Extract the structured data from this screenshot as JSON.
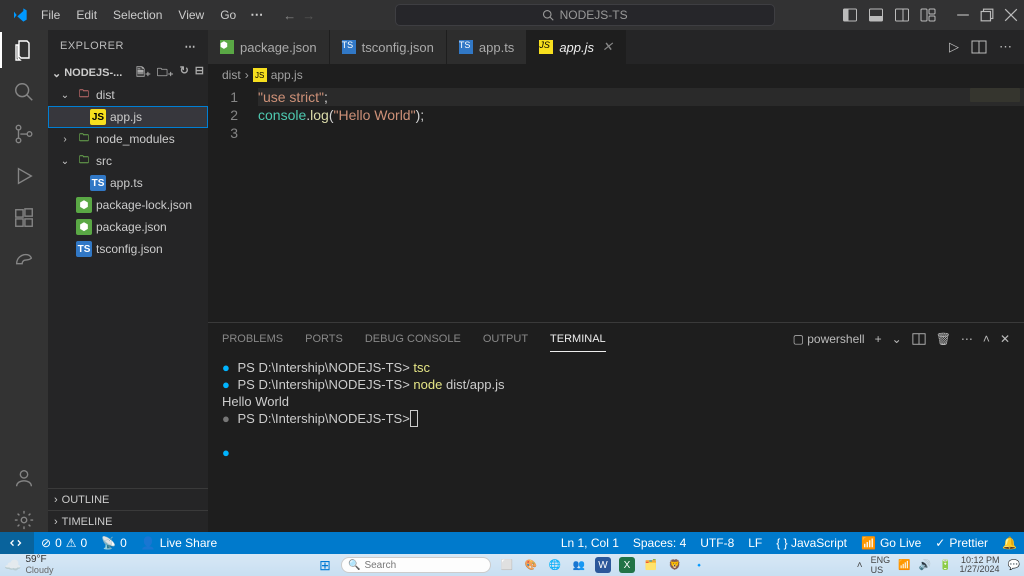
{
  "title_menu": [
    "File",
    "Edit",
    "Selection",
    "View",
    "Go"
  ],
  "search_placeholder": "NODEJS-TS",
  "explorer": {
    "title": "EXPLORER",
    "root": "NODEJS-...",
    "tree": [
      {
        "type": "folder",
        "name": "dist",
        "open": true,
        "color": "r",
        "depth": 1
      },
      {
        "type": "file",
        "name": "app.js",
        "lang": "js",
        "depth": 2,
        "selected": true
      },
      {
        "type": "folder",
        "name": "node_modules",
        "open": false,
        "color": "g",
        "depth": 1
      },
      {
        "type": "folder",
        "name": "src",
        "open": true,
        "color": "g",
        "depth": 1
      },
      {
        "type": "file",
        "name": "app.ts",
        "lang": "ts",
        "depth": 2
      },
      {
        "type": "file",
        "name": "package-lock.json",
        "lang": "npm",
        "depth": 1
      },
      {
        "type": "file",
        "name": "package.json",
        "lang": "npm",
        "depth": 1
      },
      {
        "type": "file",
        "name": "tsconfig.json",
        "lang": "ts",
        "depth": 1
      }
    ],
    "sections": [
      "OUTLINE",
      "TIMELINE"
    ]
  },
  "tabs": [
    {
      "label": "package.json",
      "lang": "npm"
    },
    {
      "label": "tsconfig.json",
      "lang": "ts"
    },
    {
      "label": "app.ts",
      "lang": "ts"
    },
    {
      "label": "app.js",
      "lang": "js",
      "active": true,
      "italic": true
    }
  ],
  "breadcrumb": [
    "dist",
    "app.js"
  ],
  "code": {
    "lines": [
      {
        "n": 1,
        "tokens": [
          {
            "t": "\"use strict\"",
            "c": "s"
          },
          {
            "t": ";",
            "c": "pn"
          }
        ],
        "hl": true
      },
      {
        "n": 2,
        "tokens": [
          {
            "t": "console",
            "c": "c-console"
          },
          {
            "t": ".",
            "c": "pn"
          },
          {
            "t": "log",
            "c": "fn"
          },
          {
            "t": "(",
            "c": "pn"
          },
          {
            "t": "\"Hello World\"",
            "c": "s"
          },
          {
            "t": ");",
            "c": "pn"
          }
        ]
      },
      {
        "n": 3,
        "tokens": []
      }
    ]
  },
  "panel": {
    "tabs": [
      "PROBLEMS",
      "PORTS",
      "DEBUG CONSOLE",
      "OUTPUT",
      "TERMINAL"
    ],
    "active": "TERMINAL",
    "shell": "powershell",
    "lines": [
      {
        "dot": "b",
        "prompt": "PS D:\\Intership\\NODEJS-TS>",
        "cmd": "tsc"
      },
      {
        "dot": "b",
        "prompt": "PS D:\\Intership\\NODEJS-TS>",
        "cmd": "node dist/app.js"
      },
      {
        "out": "Hello World"
      },
      {
        "dot": "g",
        "prompt": "PS D:\\Intership\\NODEJS-TS>",
        "cursor": true
      },
      {
        "blank": true
      },
      {
        "dot": "b"
      }
    ]
  },
  "status": {
    "errors": "0",
    "warnings": "0",
    "ports": "0",
    "live": "Live Share",
    "right": [
      "Ln 1, Col 1",
      "Spaces: 4",
      "UTF-8",
      "LF",
      "{ } JavaScript",
      "Go Live",
      "Prettier"
    ]
  },
  "taskbar": {
    "temp": "59°F",
    "cond": "Cloudy",
    "search": "Search",
    "time": "10:12 PM",
    "date": "1/27/2024"
  }
}
